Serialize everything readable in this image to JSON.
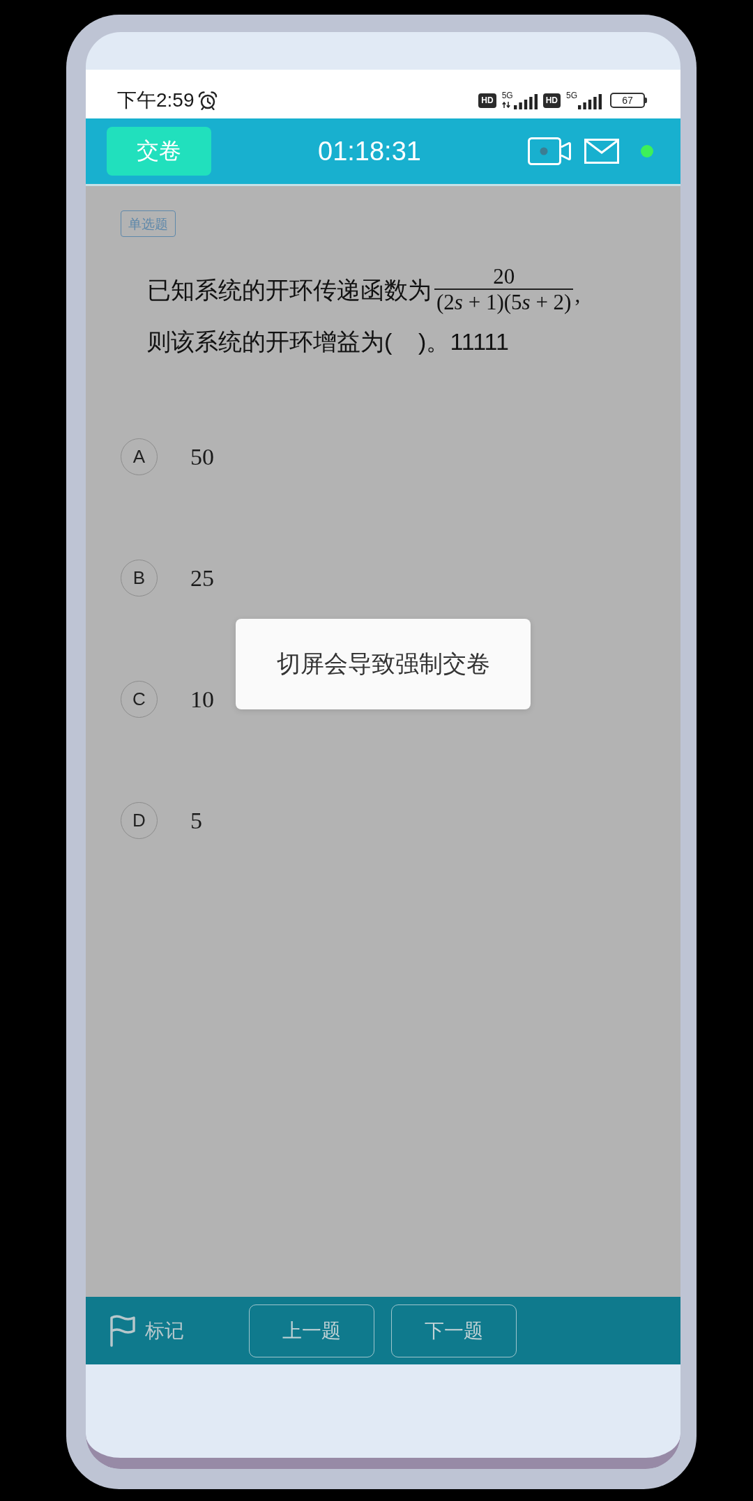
{
  "status_bar": {
    "time": "下午2:59",
    "sims": [
      {
        "badge": "HD",
        "network": "5G",
        "data_active": true
      },
      {
        "badge": "HD",
        "network": "5G",
        "data_active": false
      }
    ],
    "battery": "67"
  },
  "header": {
    "submit_button": "交卷",
    "timer": "01:18:31"
  },
  "question": {
    "type_tag": "单选题",
    "text_before": "已知系统的开环传递函数为",
    "formula": {
      "numerator": "20",
      "denominator": "(2s + 1)(5s + 2)",
      "suffix": ","
    },
    "line_2": "则该系统的开环增益为(    )。11111"
  },
  "options": [
    {
      "letter": "A",
      "text": "50",
      "selected": false
    },
    {
      "letter": "B",
      "text": "25",
      "selected": false
    },
    {
      "letter": "C",
      "text": "10",
      "selected": false
    },
    {
      "letter": "D",
      "text": "5",
      "selected": false
    }
  ],
  "toast": {
    "message": "切屏会导致强制交卷"
  },
  "bottom_bar": {
    "mark_label": "标记",
    "buttons": [
      "上一题",
      "下一题"
    ]
  }
}
